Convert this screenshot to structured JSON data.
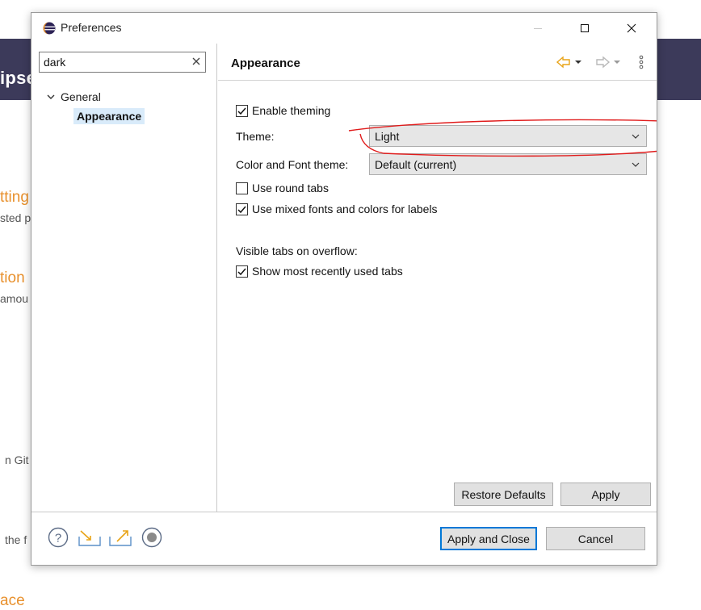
{
  "background": {
    "header_text": "ipse",
    "fragments": [
      "tting",
      "sted p",
      "tion",
      "amou",
      "n Git r",
      "the f",
      "ace"
    ]
  },
  "dialog": {
    "title": "Preferences",
    "filter": {
      "value": "dark",
      "placeholder": ""
    },
    "tree": {
      "general": "General",
      "appearance": "Appearance"
    },
    "page_title": "Appearance",
    "options": {
      "enable_theming": {
        "label": "Enable theming",
        "checked": true
      },
      "theme": {
        "label": "Theme:",
        "value": "Light"
      },
      "color_font_theme": {
        "label": "Color and Font theme:",
        "value": "Default (current)"
      },
      "use_round_tabs": {
        "label": "Use round tabs",
        "checked": false
      },
      "mixed_fonts": {
        "label": "Use mixed fonts and colors for labels",
        "checked": true
      },
      "visible_tabs_label": "Visible tabs on overflow:",
      "show_recent_tabs": {
        "label": "Show most recently used tabs",
        "checked": true
      }
    },
    "buttons": {
      "restore_defaults": "Restore Defaults",
      "apply": "Apply",
      "apply_and_close": "Apply and Close",
      "cancel": "Cancel"
    },
    "icons": {
      "app": "eclipse-icon",
      "minimize": "minimize-icon",
      "maximize": "maximize-icon",
      "close": "close-icon",
      "back": "back-arrow-icon",
      "forward": "forward-arrow-icon",
      "menu": "view-menu-icon",
      "help": "help-icon",
      "import": "import-icon",
      "export": "export-icon",
      "record": "record-icon"
    },
    "colors": {
      "accent": "#0078d7",
      "back_arrow": "#e8a317",
      "selection": "#d9ebfa",
      "annotation": "#e01b1b"
    }
  }
}
